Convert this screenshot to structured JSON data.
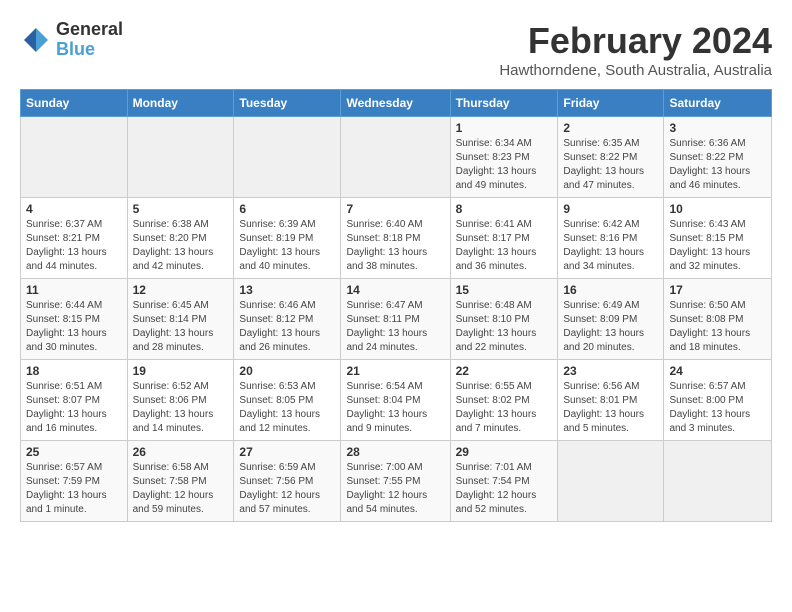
{
  "logo": {
    "line1": "General",
    "line2": "Blue"
  },
  "title": "February 2024",
  "subtitle": "Hawthorndene, South Australia, Australia",
  "days_of_week": [
    "Sunday",
    "Monday",
    "Tuesday",
    "Wednesday",
    "Thursday",
    "Friday",
    "Saturday"
  ],
  "weeks": [
    [
      {
        "day": "",
        "info": ""
      },
      {
        "day": "",
        "info": ""
      },
      {
        "day": "",
        "info": ""
      },
      {
        "day": "",
        "info": ""
      },
      {
        "day": "1",
        "info": "Sunrise: 6:34 AM\nSunset: 8:23 PM\nDaylight: 13 hours\nand 49 minutes."
      },
      {
        "day": "2",
        "info": "Sunrise: 6:35 AM\nSunset: 8:22 PM\nDaylight: 13 hours\nand 47 minutes."
      },
      {
        "day": "3",
        "info": "Sunrise: 6:36 AM\nSunset: 8:22 PM\nDaylight: 13 hours\nand 46 minutes."
      }
    ],
    [
      {
        "day": "4",
        "info": "Sunrise: 6:37 AM\nSunset: 8:21 PM\nDaylight: 13 hours\nand 44 minutes."
      },
      {
        "day": "5",
        "info": "Sunrise: 6:38 AM\nSunset: 8:20 PM\nDaylight: 13 hours\nand 42 minutes."
      },
      {
        "day": "6",
        "info": "Sunrise: 6:39 AM\nSunset: 8:19 PM\nDaylight: 13 hours\nand 40 minutes."
      },
      {
        "day": "7",
        "info": "Sunrise: 6:40 AM\nSunset: 8:18 PM\nDaylight: 13 hours\nand 38 minutes."
      },
      {
        "day": "8",
        "info": "Sunrise: 6:41 AM\nSunset: 8:17 PM\nDaylight: 13 hours\nand 36 minutes."
      },
      {
        "day": "9",
        "info": "Sunrise: 6:42 AM\nSunset: 8:16 PM\nDaylight: 13 hours\nand 34 minutes."
      },
      {
        "day": "10",
        "info": "Sunrise: 6:43 AM\nSunset: 8:15 PM\nDaylight: 13 hours\nand 32 minutes."
      }
    ],
    [
      {
        "day": "11",
        "info": "Sunrise: 6:44 AM\nSunset: 8:15 PM\nDaylight: 13 hours\nand 30 minutes."
      },
      {
        "day": "12",
        "info": "Sunrise: 6:45 AM\nSunset: 8:14 PM\nDaylight: 13 hours\nand 28 minutes."
      },
      {
        "day": "13",
        "info": "Sunrise: 6:46 AM\nSunset: 8:12 PM\nDaylight: 13 hours\nand 26 minutes."
      },
      {
        "day": "14",
        "info": "Sunrise: 6:47 AM\nSunset: 8:11 PM\nDaylight: 13 hours\nand 24 minutes."
      },
      {
        "day": "15",
        "info": "Sunrise: 6:48 AM\nSunset: 8:10 PM\nDaylight: 13 hours\nand 22 minutes."
      },
      {
        "day": "16",
        "info": "Sunrise: 6:49 AM\nSunset: 8:09 PM\nDaylight: 13 hours\nand 20 minutes."
      },
      {
        "day": "17",
        "info": "Sunrise: 6:50 AM\nSunset: 8:08 PM\nDaylight: 13 hours\nand 18 minutes."
      }
    ],
    [
      {
        "day": "18",
        "info": "Sunrise: 6:51 AM\nSunset: 8:07 PM\nDaylight: 13 hours\nand 16 minutes."
      },
      {
        "day": "19",
        "info": "Sunrise: 6:52 AM\nSunset: 8:06 PM\nDaylight: 13 hours\nand 14 minutes."
      },
      {
        "day": "20",
        "info": "Sunrise: 6:53 AM\nSunset: 8:05 PM\nDaylight: 13 hours\nand 12 minutes."
      },
      {
        "day": "21",
        "info": "Sunrise: 6:54 AM\nSunset: 8:04 PM\nDaylight: 13 hours\nand 9 minutes."
      },
      {
        "day": "22",
        "info": "Sunrise: 6:55 AM\nSunset: 8:02 PM\nDaylight: 13 hours\nand 7 minutes."
      },
      {
        "day": "23",
        "info": "Sunrise: 6:56 AM\nSunset: 8:01 PM\nDaylight: 13 hours\nand 5 minutes."
      },
      {
        "day": "24",
        "info": "Sunrise: 6:57 AM\nSunset: 8:00 PM\nDaylight: 13 hours\nand 3 minutes."
      }
    ],
    [
      {
        "day": "25",
        "info": "Sunrise: 6:57 AM\nSunset: 7:59 PM\nDaylight: 13 hours\nand 1 minute."
      },
      {
        "day": "26",
        "info": "Sunrise: 6:58 AM\nSunset: 7:58 PM\nDaylight: 12 hours\nand 59 minutes."
      },
      {
        "day": "27",
        "info": "Sunrise: 6:59 AM\nSunset: 7:56 PM\nDaylight: 12 hours\nand 57 minutes."
      },
      {
        "day": "28",
        "info": "Sunrise: 7:00 AM\nSunset: 7:55 PM\nDaylight: 12 hours\nand 54 minutes."
      },
      {
        "day": "29",
        "info": "Sunrise: 7:01 AM\nSunset: 7:54 PM\nDaylight: 12 hours\nand 52 minutes."
      },
      {
        "day": "",
        "info": ""
      },
      {
        "day": "",
        "info": ""
      }
    ]
  ]
}
